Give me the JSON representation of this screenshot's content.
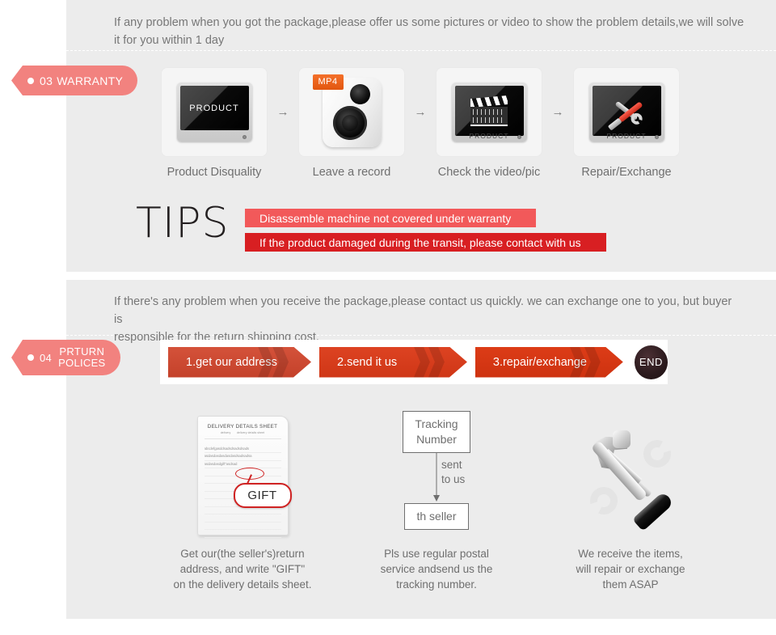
{
  "colors": {
    "panel_bg": "#ececec",
    "page_bg": "#ffffff",
    "tag_pink": "#f2827f",
    "tip_light_red": "#f2595a",
    "tip_dark_red": "#d81f22",
    "chevron_red": "#d4523a",
    "end_dark": "#2b1a1d",
    "body_text": "#6f6f6f",
    "mp4_orange": "#e2560f",
    "gift_red": "#cf2222"
  },
  "warranty": {
    "tag": {
      "number": "03",
      "label": "WARRANTY",
      "dot_icon": "bullet-dot-icon"
    },
    "intro": "If any problem when you got the package,please offer us some pictures or video to show the problem details,we will solve\n it for you within 1 day",
    "arrow_glyph": "→",
    "steps": [
      {
        "label": "Product Disquality",
        "icon": "monitor-product-icon",
        "screen_text": "PRODUCT",
        "base_text": ""
      },
      {
        "label": "Leave a record",
        "icon": "mp4-camera-icon",
        "badge": "MP4"
      },
      {
        "label": "Check the video/pic",
        "icon": "monitor-clapperboard-icon",
        "screen_text": "",
        "base_text": "PRODUCT"
      },
      {
        "label": "Repair/Exchange",
        "icon": "monitor-tools-icon",
        "screen_text": "",
        "base_text": "PRODUCT"
      }
    ],
    "tips": {
      "heading": "TIPS",
      "bars": [
        "Disassemble machine not covered under warranty",
        "If the product damaged during the transit, please contact with us"
      ]
    }
  },
  "return_policy": {
    "tag": {
      "number": "04",
      "line1": "PRTURN",
      "line2": "POLICES",
      "dot_icon": "bullet-dot-icon"
    },
    "intro": "If  there's any problem when you receive the package,please contact us quickly. we can exchange one to you, but buyer is\nresponsible for the return shipping cost.",
    "flow": [
      {
        "label": "1.get our address"
      },
      {
        "label": "2.send it us"
      },
      {
        "label": "3.repair/exchange"
      }
    ],
    "end_label": "END",
    "columns": [
      {
        "art": "delivery-details-sheet-icon",
        "sheet": {
          "title": "DELIVERY DETAILS SHEET",
          "subtitle_left": "delivery",
          "subtitle_right": "delivery details sheet",
          "body_lines": [
            "abcdefgasddsadsdsadsdsads",
            "asdasdasdasdasdasdsadsadsa",
            "asdasdasdgift\"asdsad"
          ],
          "callout": "GIFT"
        },
        "caption": "Get our(the seller's)return\naddress, and write \"GIFT\"\non the delivery details sheet."
      },
      {
        "art": "tracking-number-flow-icon",
        "diagram": {
          "top_box": "Tracking\nNumber",
          "arrow_label": "sent\nto us",
          "bottom_box": "th seller"
        },
        "caption": "Pls use regular postal\nservice andsend us the\n tracking number."
      },
      {
        "art": "hammer-wrench-screwdriver-icon",
        "caption": "We receive the items,\nwill repair or exchange\n them ASAP"
      }
    ]
  }
}
